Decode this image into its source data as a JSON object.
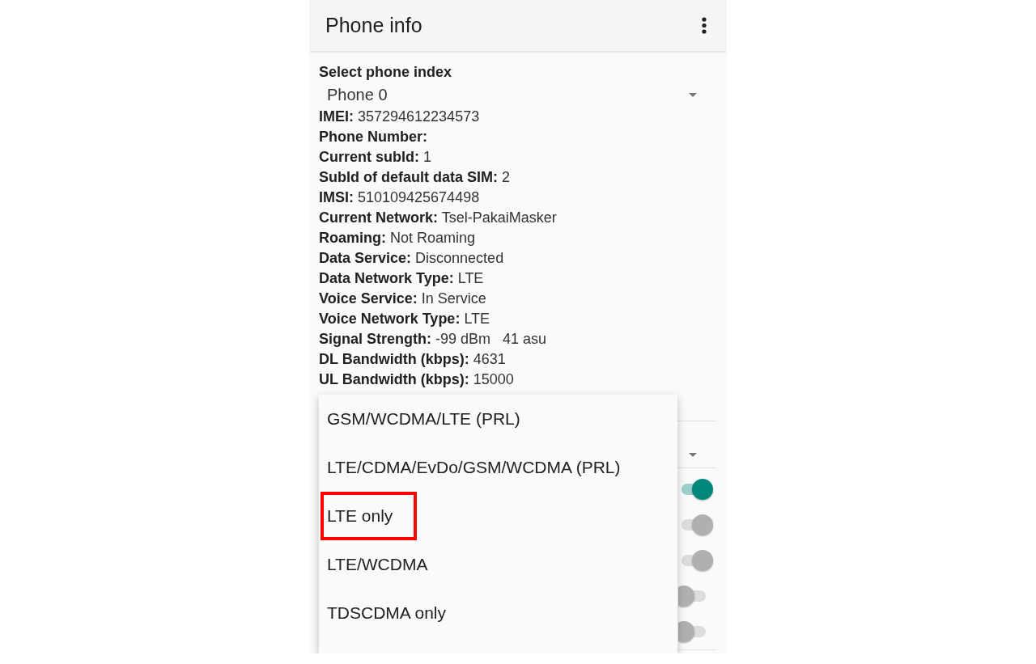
{
  "app_bar": {
    "title": "Phone info"
  },
  "phone_index": {
    "label": "Select phone index",
    "value": "Phone 0"
  },
  "info_rows": [
    {
      "label": "IMEI:",
      "value": "357294612234573"
    },
    {
      "label": "Phone Number:"
    },
    {
      "label": "Current subId:",
      "value": "1"
    },
    {
      "label": "SubId of default data SIM:",
      "value": "2"
    },
    {
      "label": "IMSI:",
      "value": "510109425674498"
    },
    {
      "label": "Current Network:",
      "value": "Tsel-PakaiMasker"
    },
    {
      "label": "Roaming:",
      "value": "Not Roaming"
    },
    {
      "label": "Data Service:",
      "value": "Disconnected"
    },
    {
      "label": "Data Network Type:",
      "value": "LTE"
    },
    {
      "label": "Voice Service:",
      "value": "In Service"
    },
    {
      "label": "Voice Network Type:",
      "value": "LTE"
    },
    {
      "label": "Signal Strength:",
      "value": "-99 dBm   41 asu"
    },
    {
      "label": "DL Bandwidth (kbps):",
      "value": "4631"
    },
    {
      "label": "UL Bandwidth (kbps):",
      "value": "15000"
    }
  ],
  "switches": [
    {
      "on": true,
      "disabled": false
    },
    {
      "on": true,
      "disabled": true
    },
    {
      "on": true,
      "disabled": true
    },
    {
      "on": false,
      "disabled": true
    },
    {
      "on": false,
      "disabled": true
    }
  ],
  "network_type_menu": {
    "options": [
      {
        "label": "GSM/WCDMA/LTE (PRL)",
        "highlighted": false
      },
      {
        "label": "LTE/CDMA/EvDo/GSM/WCDMA (PRL)",
        "highlighted": false
      },
      {
        "label": "LTE only",
        "highlighted": true
      },
      {
        "label": "LTE/WCDMA",
        "highlighted": false
      },
      {
        "label": "TDSCDMA only",
        "highlighted": false
      }
    ]
  }
}
